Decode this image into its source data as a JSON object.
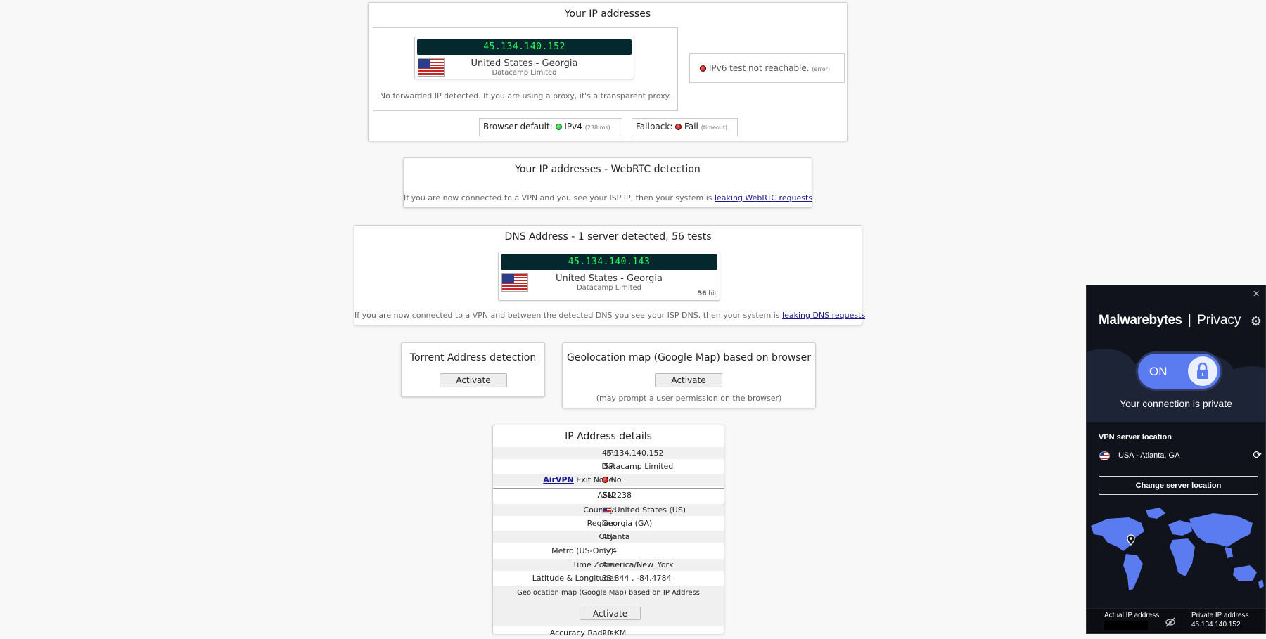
{
  "ip_panel": {
    "title": "Your IP addresses",
    "ipv4": {
      "ip": "45.134.140.152",
      "location": "United States - Georgia",
      "isp": "Datacamp Limited"
    },
    "forward_note": "No forwarded IP detected. If you are using a proxy, it's a transparent proxy.",
    "ipv6_text": "IPv6 test not reachable.",
    "ipv6_note": "(error)",
    "browser_default_label": "Browser default:",
    "browser_default_value": "IPv4",
    "browser_default_time": "(238 ms)",
    "fallback_label": "Fallback:",
    "fallback_value": "Fail",
    "fallback_note": "(timeout)"
  },
  "webrtc": {
    "title": "Your IP addresses - WebRTC detection",
    "note": "If you are now connected to a VPN and you see your ISP IP, then your system is",
    "link": "leaking WebRTC requests"
  },
  "dns": {
    "title": "DNS Address - 1 server detected, 56 tests",
    "ip": "45.134.140.143",
    "location": "United States - Georgia",
    "isp": "Datacamp Limited",
    "hit": "56",
    "hit_label": "hit",
    "note": "If you are now connected to a VPN and between the detected DNS you see your ISP DNS, then your system is",
    "link": "leaking DNS requests"
  },
  "torrent": {
    "title": "Torrent Address detection",
    "button": "Activate"
  },
  "geomap": {
    "title": "Geolocation map (Google Map) based on browser",
    "button": "Activate",
    "note": "(may prompt a user permission on the browser)"
  },
  "details": {
    "title": "IP Address details",
    "airvpn": "AirVPN",
    "rows": [
      {
        "label": "IP:",
        "value": "45.134.140.152"
      },
      {
        "label": "ISP:",
        "value": "Datacamp Limited"
      },
      {
        "label": "Exit Node:",
        "value": "No"
      },
      {
        "label": "ASN:",
        "value": "212238"
      },
      {
        "label": "Country:",
        "value": "United States (US)"
      },
      {
        "label": "Region:",
        "value": "Georgia (GA)"
      },
      {
        "label": "City:",
        "value": "Atlanta"
      },
      {
        "label": "Metro (US-Only):",
        "value": "524"
      },
      {
        "label": "Time Zone:",
        "value": "America/New_York"
      },
      {
        "label": "Latitude & Longitude:",
        "value": "33.844 , -84.4784"
      }
    ],
    "geomap_label": "Geolocation map (Google Map) based on IP Address",
    "geomap_button": "Activate",
    "accuracy_label": "Accuracy Radius:",
    "accuracy_value": "20 KM"
  },
  "vpn": {
    "close": "×",
    "brand": "Malwarebytes",
    "separator": "|",
    "product": "Privacy",
    "toggle": "ON",
    "status": "Your connection is private",
    "server_heading": "VPN server location",
    "server_value": "USA - Atlanta, GA",
    "change_button": "Change server location",
    "actual_label": "Actual IP address",
    "private_label": "Private IP address",
    "private_value": "45.134.140.152",
    "colors": {
      "accent": "#5b7cf0",
      "panel": "#10131c",
      "map": "#5b7cf0"
    }
  }
}
